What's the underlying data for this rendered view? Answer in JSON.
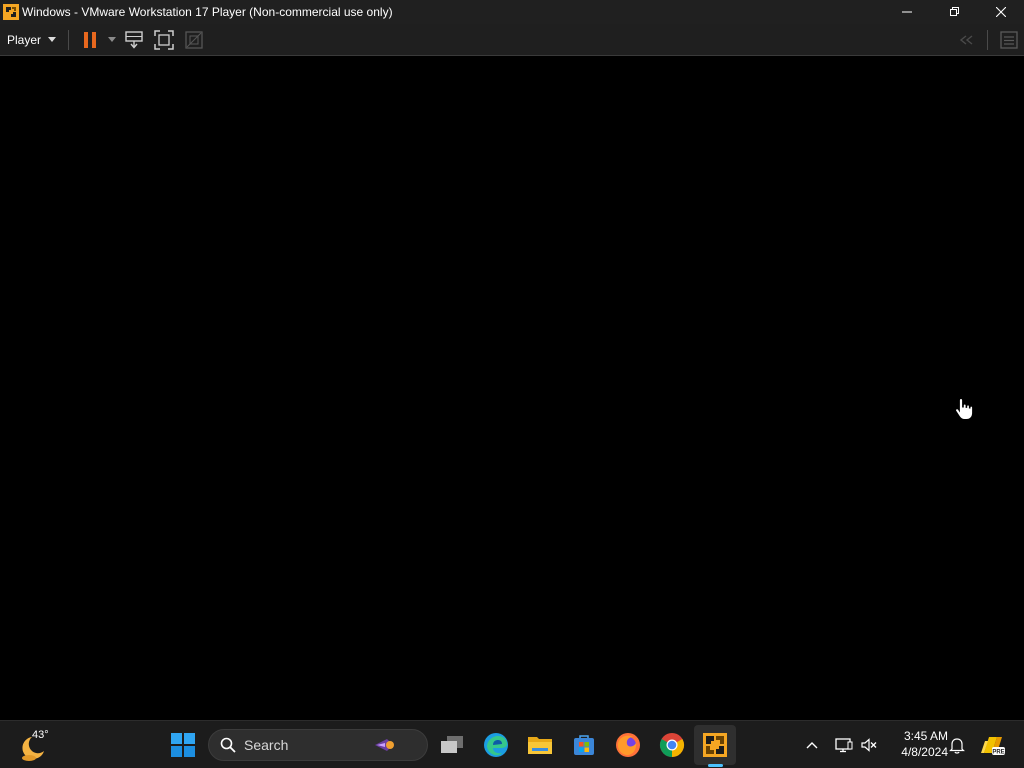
{
  "window": {
    "title": "Windows - VMware Workstation 17 Player (Non-commercial use only)",
    "controls": [
      "minimize",
      "restore",
      "close"
    ]
  },
  "toolbar": {
    "player_menu_label": "Player",
    "buttons": [
      "pause-icon",
      "send-ctrl-alt-del-icon",
      "full-screen-icon",
      "unity-icon"
    ],
    "right_buttons": [
      "back-arrows-icon",
      "library-icon"
    ],
    "pause_color": "#e8681e"
  },
  "vm": {
    "screen_color": "#000000",
    "cursor": "hand-pointer-icon"
  },
  "taskbar": {
    "weather": {
      "temperature": "43°",
      "icon": "moon-weather-icon"
    },
    "search": {
      "label": "Search"
    },
    "apps": [
      "windows-start-icon",
      "task-view-icon",
      "edge-icon",
      "file-explorer-icon",
      "microsoft-store-icon",
      "firefox-icon",
      "chrome-icon",
      "vmware-player-icon"
    ],
    "active_app": "vmware-player-icon",
    "accent_color": "#4cc2ff",
    "tray": {
      "icons": [
        "chevron-up-icon",
        "network-icon",
        "volume-muted-icon",
        "notifications-icon",
        "copilot-pre-icon"
      ],
      "time": "3:45 AM",
      "date": "4/8/2024"
    }
  }
}
